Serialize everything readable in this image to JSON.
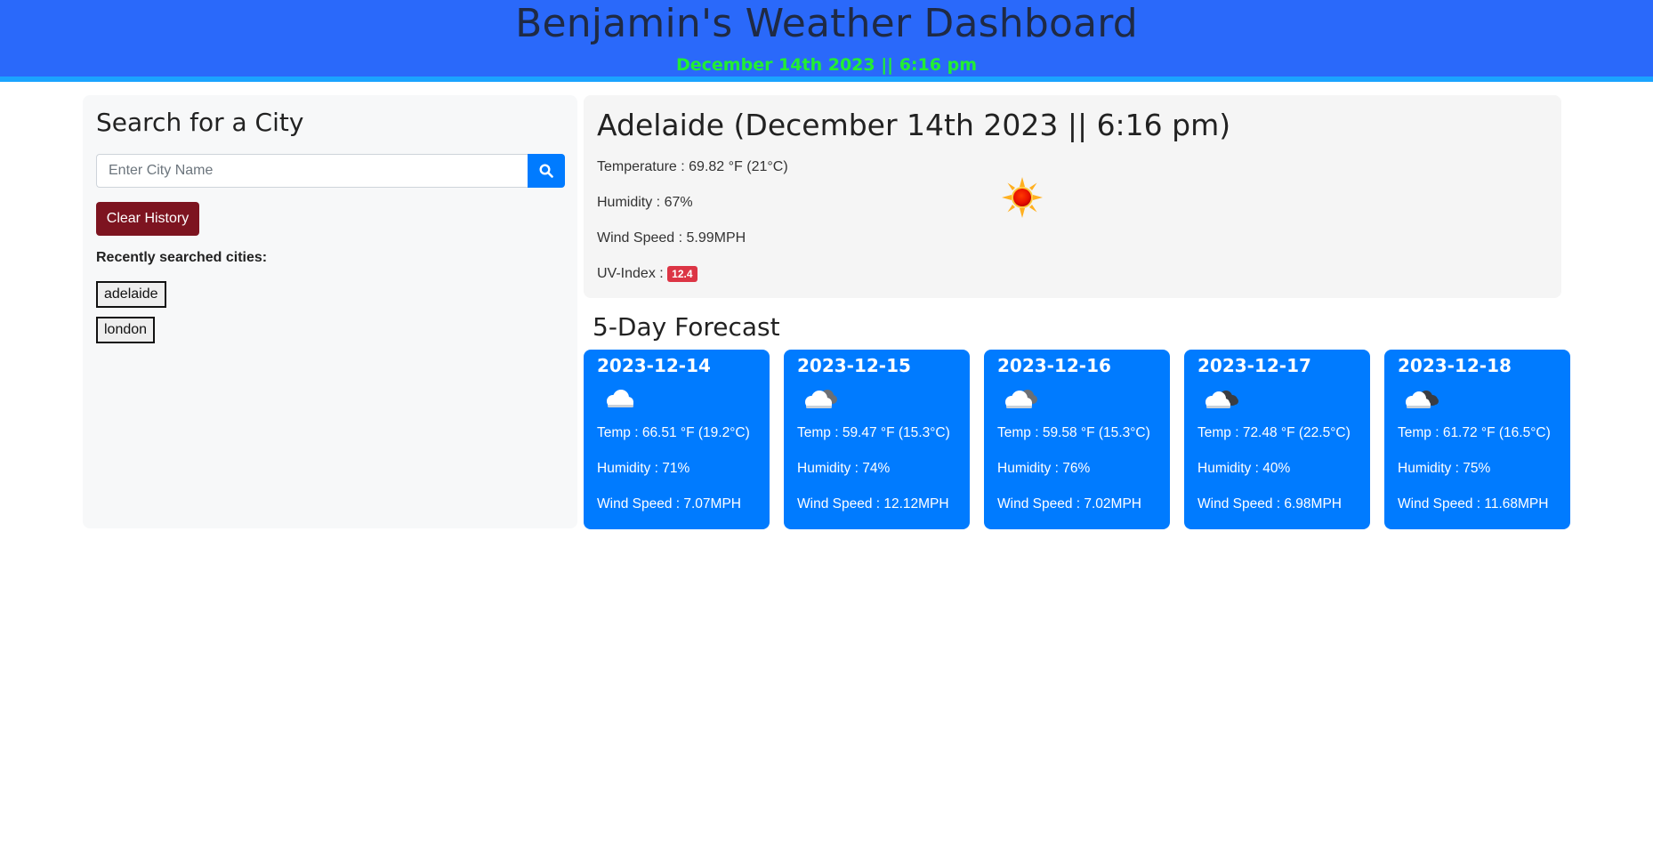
{
  "header": {
    "title": "Benjamin's Weather Dashboard",
    "datetime": "December 14th 2023 || 6:16 pm"
  },
  "sidebar": {
    "heading": "Search for a City",
    "search_placeholder": "Enter City Name",
    "search_value": "",
    "clear_button": "Clear History",
    "recent_label": "Recently searched cities:",
    "cities": [
      "adelaide",
      "london"
    ]
  },
  "current": {
    "heading": "Adelaide (December 14th 2023 || 6:16 pm)",
    "temperature": "Temperature : 69.82 °F (21°C)",
    "humidity": "Humidity : 67%",
    "wind": "Wind Speed : 5.99MPH",
    "uv_label": "UV-Index :",
    "uv_value": "12.4",
    "uv_color": "#dc3545",
    "icon": "sun-icon"
  },
  "forecast": {
    "title": "5-Day Forecast",
    "days": [
      {
        "date": "2023-12-14",
        "icon": "cloud-icon",
        "temp": "Temp : 66.51 °F (19.2°C)",
        "humidity": "Humidity : 71%",
        "wind": "Wind Speed : 7.07MPH"
      },
      {
        "date": "2023-12-15",
        "icon": "cloudy-icon",
        "temp": "Temp : 59.47 °F (15.3°C)",
        "humidity": "Humidity : 74%",
        "wind": "Wind Speed : 12.12MPH"
      },
      {
        "date": "2023-12-16",
        "icon": "cloudy-icon",
        "temp": "Temp : 59.58 °F (15.3°C)",
        "humidity": "Humidity : 76%",
        "wind": "Wind Speed : 7.02MPH"
      },
      {
        "date": "2023-12-17",
        "icon": "dark-cloud-icon",
        "temp": "Temp : 72.48 °F (22.5°C)",
        "humidity": "Humidity : 40%",
        "wind": "Wind Speed : 6.98MPH"
      },
      {
        "date": "2023-12-18",
        "icon": "dark-cloud-icon",
        "temp": "Temp : 61.72 °F (16.5°C)",
        "humidity": "Humidity : 75%",
        "wind": "Wind Speed : 11.68MPH"
      }
    ]
  },
  "colors": {
    "header_bg": "#2a69fa",
    "datetime": "#22ee33",
    "card_bg": "#007bff",
    "clear_button": "#7d1420"
  }
}
